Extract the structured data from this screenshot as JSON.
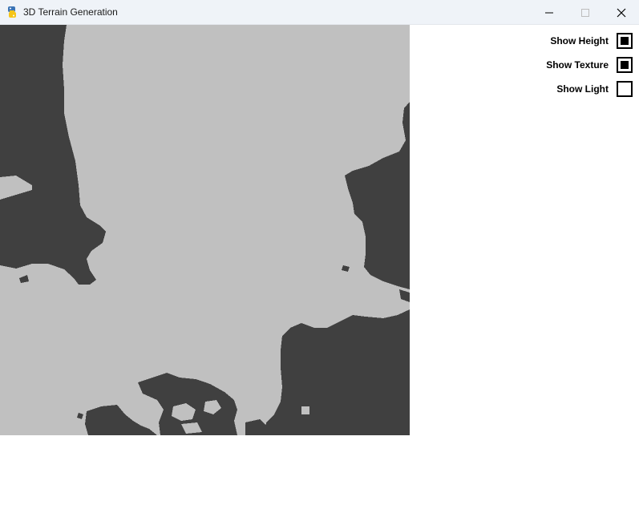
{
  "window": {
    "title": "3D Terrain Generation",
    "icon": "python-logo-icon"
  },
  "terrain": {
    "colors": {
      "land": "#c0c0c0",
      "water": "#404040"
    }
  },
  "options": [
    {
      "label": "Show Height",
      "checked": true
    },
    {
      "label": "Show Texture",
      "checked": true
    },
    {
      "label": "Show Light",
      "checked": false
    }
  ]
}
